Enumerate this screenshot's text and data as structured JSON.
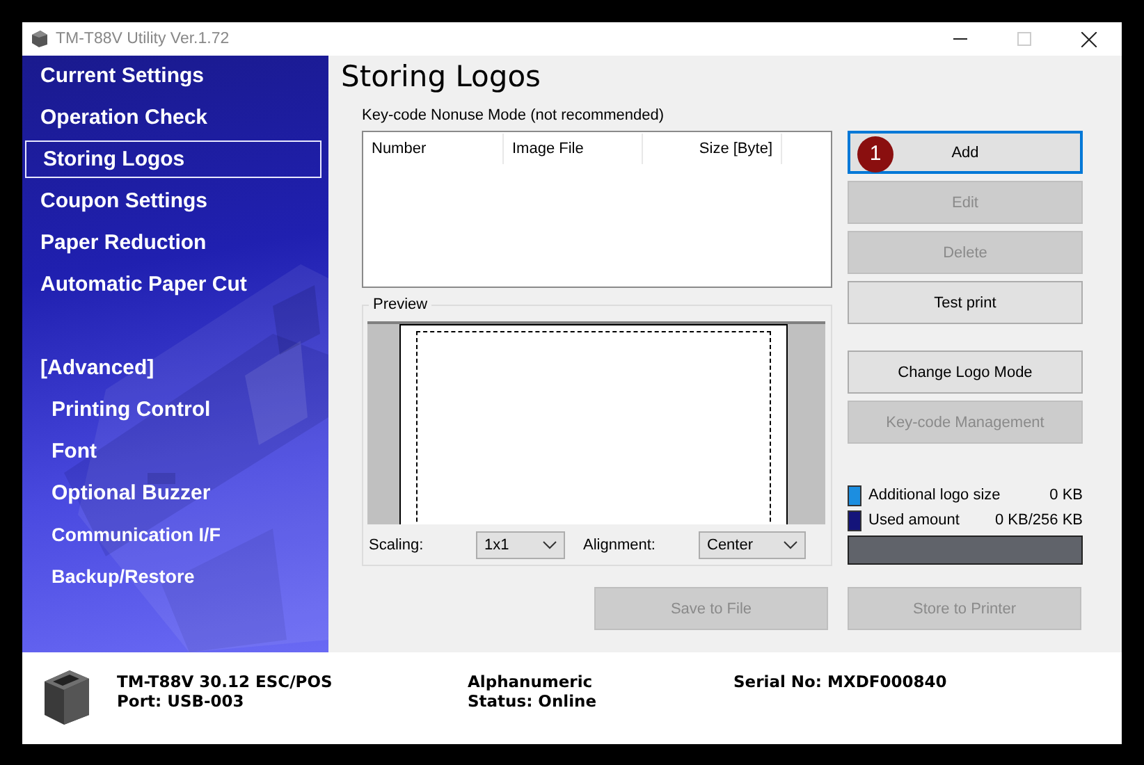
{
  "window": {
    "title": "TM-T88V Utility Ver.1.72"
  },
  "sidebar": {
    "items": [
      {
        "label": "Current Settings",
        "kind": "main",
        "selected": false
      },
      {
        "label": "Operation Check",
        "kind": "main",
        "selected": false
      },
      {
        "label": "Storing Logos",
        "kind": "main",
        "selected": true
      },
      {
        "label": "Coupon Settings",
        "kind": "main",
        "selected": false
      },
      {
        "label": "Paper Reduction",
        "kind": "main",
        "selected": false
      },
      {
        "label": "Automatic Paper Cut",
        "kind": "main",
        "selected": false
      },
      {
        "label": "[Advanced]",
        "kind": "section",
        "selected": false
      },
      {
        "label": "Printing Control",
        "kind": "sub",
        "selected": false
      },
      {
        "label": "Font",
        "kind": "sub",
        "selected": false
      },
      {
        "label": "Optional Buzzer",
        "kind": "sub",
        "selected": false
      },
      {
        "label": "Communication I/F",
        "kind": "small",
        "selected": false
      },
      {
        "label": "Backup/Restore",
        "kind": "small",
        "selected": false
      }
    ]
  },
  "page": {
    "title": "Storing Logos",
    "mode_label": "Key-code Nonuse Mode (not recommended)",
    "logo_table": {
      "columns": [
        "Number",
        "Image File",
        "Size [Byte]"
      ]
    },
    "buttons": [
      {
        "label": "Add",
        "disabled": false,
        "focused": true,
        "badge": "1"
      },
      {
        "label": "Edit",
        "disabled": true,
        "focused": false
      },
      {
        "label": "Delete",
        "disabled": true,
        "focused": false
      },
      {
        "label": "Test print",
        "disabled": false,
        "focused": false
      },
      {
        "label": "Change Logo Mode",
        "disabled": false,
        "focused": false
      },
      {
        "label": "Key-code Management",
        "disabled": true,
        "focused": false
      }
    ],
    "preview": {
      "label": "Preview",
      "scaling": {
        "label": "Scaling:",
        "value": "1x1"
      },
      "alignment": {
        "label": "Alignment:",
        "value": "Center"
      }
    },
    "memory": {
      "legend": [
        {
          "label": "Additional logo size",
          "value": "0 KB",
          "color": "#1c8ee0"
        },
        {
          "label": "Used amount",
          "value": "0 KB/256 KB",
          "color": "#14147a"
        }
      ]
    },
    "bottom_buttons": [
      {
        "label": "Save to File",
        "disabled": true
      },
      {
        "label": "Store to Printer",
        "disabled": true
      }
    ]
  },
  "status_bar": {
    "model": "TM-T88V 30.12 ESC/POS",
    "port": "Port: USB-003",
    "mode": "Alphanumeric",
    "status": "Status: Online",
    "serial": "Serial No: MXDF000840"
  }
}
